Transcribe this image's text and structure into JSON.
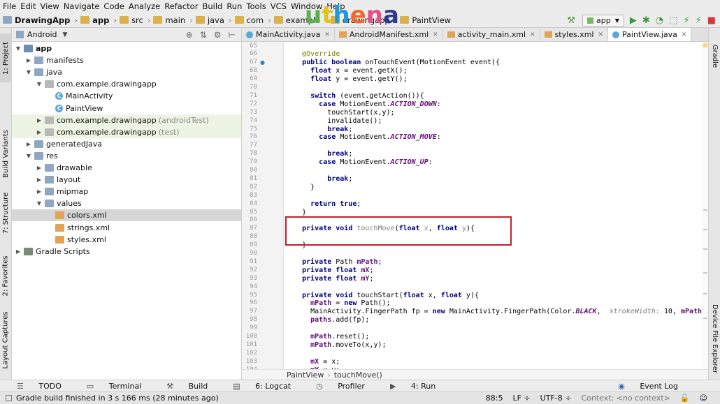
{
  "menu": [
    "File",
    "Edit",
    "View",
    "Navigate",
    "Code",
    "Analyze",
    "Refactor",
    "Build",
    "Run",
    "Tools",
    "VCS",
    "Window",
    "Help"
  ],
  "breadcrumbs": [
    {
      "label": "DrawingApp",
      "bold": true
    },
    {
      "label": "app",
      "bold": true
    },
    {
      "label": "src",
      "bold": false
    },
    {
      "label": "main",
      "bold": false
    },
    {
      "label": "java",
      "bold": false
    },
    {
      "label": "com",
      "bold": false
    },
    {
      "label": "example",
      "bold": false
    },
    {
      "label": "drawingapp",
      "bold": false
    },
    {
      "label": "PaintView",
      "bold": false
    }
  ],
  "watermark": "uthena",
  "watermark_colors": [
    "#5ab04a",
    "#e0c21d",
    "#1e9bd7",
    "#ec6a2c",
    "#e84e88",
    "#2c3a8c"
  ],
  "run_config": "app",
  "project_panel": {
    "view": "Android",
    "tree": [
      {
        "label": "app",
        "depth": 0,
        "open": true,
        "icon": "mod",
        "bold": true
      },
      {
        "label": "manifests",
        "depth": 1,
        "open": false,
        "icon": "folder"
      },
      {
        "label": "java",
        "depth": 1,
        "open": true,
        "icon": "folder"
      },
      {
        "label": "com.example.drawingapp",
        "depth": 2,
        "open": true,
        "icon": "pkg"
      },
      {
        "label": "MainActivity",
        "depth": 3,
        "icon": "java"
      },
      {
        "label": "PaintView",
        "depth": 3,
        "icon": "java"
      },
      {
        "label": "com.example.drawingapp",
        "suffix": "(androidTest)",
        "depth": 2,
        "open": false,
        "icon": "pkg",
        "green": true
      },
      {
        "label": "com.example.drawingapp",
        "suffix": "(test)",
        "depth": 2,
        "open": false,
        "icon": "pkg",
        "green": true
      },
      {
        "label": "generatedJava",
        "depth": 1,
        "open": false,
        "icon": "folder"
      },
      {
        "label": "res",
        "depth": 1,
        "open": true,
        "icon": "res"
      },
      {
        "label": "drawable",
        "depth": 2,
        "open": false,
        "icon": "folder"
      },
      {
        "label": "layout",
        "depth": 2,
        "open": false,
        "icon": "folder"
      },
      {
        "label": "mipmap",
        "depth": 2,
        "open": false,
        "icon": "folder"
      },
      {
        "label": "values",
        "depth": 2,
        "open": true,
        "icon": "folder"
      },
      {
        "label": "colors.xml",
        "depth": 3,
        "icon": "xml",
        "selected": true
      },
      {
        "label": "strings.xml",
        "depth": 3,
        "icon": "xml"
      },
      {
        "label": "styles.xml",
        "depth": 3,
        "icon": "xml"
      },
      {
        "label": "Gradle Scripts",
        "depth": 0,
        "open": false,
        "icon": "gradle"
      }
    ]
  },
  "left_tool_tabs": [
    "1: Project",
    "Build Variants",
    "7: Structure",
    "2: Favorites",
    "Layout Captures"
  ],
  "right_tool_tabs": [
    "Gradle",
    "Device File Explorer"
  ],
  "editor_tabs": [
    {
      "label": "MainActivity.java",
      "icon": "java"
    },
    {
      "label": "AndroidManifest.xml",
      "icon": "xml"
    },
    {
      "label": "activity_main.xml",
      "icon": "xml"
    },
    {
      "label": "styles.xml",
      "icon": "xml"
    },
    {
      "label": "PaintView.java",
      "icon": "java",
      "active": true
    }
  ],
  "code": [
    {
      "n": "65",
      "t": []
    },
    {
      "n": "66",
      "t": [
        {
          "s": "    @Override",
          "c": "ann"
        }
      ]
    },
    {
      "n": "67",
      "t": [
        {
          "s": "    ",
          "c": ""
        },
        {
          "s": "public boolean ",
          "c": "kw"
        },
        {
          "s": "onTouchEvent",
          "c": "mdecl"
        },
        {
          "s": "(MotionEvent event){",
          "c": ""
        }
      ]
    },
    {
      "n": "68",
      "t": [
        {
          "s": "      ",
          "c": ""
        },
        {
          "s": "float ",
          "c": "kw"
        },
        {
          "s": "x = event.getX();",
          "c": ""
        }
      ]
    },
    {
      "n": "69",
      "t": [
        {
          "s": "      ",
          "c": ""
        },
        {
          "s": "float ",
          "c": "kw"
        },
        {
          "s": "y = event.getY();",
          "c": ""
        }
      ]
    },
    {
      "n": "70",
      "t": []
    },
    {
      "n": "71",
      "t": [
        {
          "s": "      ",
          "c": ""
        },
        {
          "s": "switch ",
          "c": "kw"
        },
        {
          "s": "(event.getAction()){",
          "c": ""
        }
      ]
    },
    {
      "n": "72",
      "t": [
        {
          "s": "        ",
          "c": ""
        },
        {
          "s": "case ",
          "c": "kw"
        },
        {
          "s": "MotionEvent.",
          "c": ""
        },
        {
          "s": "ACTION_DOWN",
          "c": "const"
        },
        {
          "s": ":",
          "c": ""
        }
      ]
    },
    {
      "n": "73",
      "t": [
        {
          "s": "          touchStart(x,y);",
          "c": ""
        }
      ]
    },
    {
      "n": "74",
      "t": [
        {
          "s": "          invalidate();",
          "c": ""
        }
      ]
    },
    {
      "n": "75",
      "t": [
        {
          "s": "          ",
          "c": ""
        },
        {
          "s": "break",
          "c": "kw"
        },
        {
          "s": ";",
          "c": ""
        }
      ]
    },
    {
      "n": "76",
      "t": [
        {
          "s": "        ",
          "c": ""
        },
        {
          "s": "case ",
          "c": "kw"
        },
        {
          "s": "MotionEvent.",
          "c": ""
        },
        {
          "s": "ACTION_MOVE",
          "c": "const"
        },
        {
          "s": ":",
          "c": ""
        }
      ]
    },
    {
      "n": "77",
      "t": []
    },
    {
      "n": "78",
      "t": [
        {
          "s": "          ",
          "c": ""
        },
        {
          "s": "break",
          "c": "kw"
        },
        {
          "s": ";",
          "c": ""
        }
      ]
    },
    {
      "n": "79",
      "t": [
        {
          "s": "        ",
          "c": ""
        },
        {
          "s": "case ",
          "c": "kw"
        },
        {
          "s": "MotionEvent.",
          "c": ""
        },
        {
          "s": "ACTION_UP",
          "c": "const"
        },
        {
          "s": ":",
          "c": ""
        }
      ]
    },
    {
      "n": "80",
      "t": []
    },
    {
      "n": "81",
      "t": [
        {
          "s": "          ",
          "c": ""
        },
        {
          "s": "break",
          "c": "kw"
        },
        {
          "s": ";",
          "c": ""
        }
      ]
    },
    {
      "n": "82",
      "t": [
        {
          "s": "      }",
          "c": ""
        }
      ]
    },
    {
      "n": "83",
      "t": []
    },
    {
      "n": "84",
      "t": [
        {
          "s": "      ",
          "c": ""
        },
        {
          "s": "return true",
          "c": "kw"
        },
        {
          "s": ";",
          "c": ""
        }
      ]
    },
    {
      "n": "85",
      "t": [
        {
          "s": "    }",
          "c": ""
        }
      ]
    },
    {
      "n": "86",
      "t": []
    },
    {
      "n": "87",
      "t": [
        {
          "s": "    ",
          "c": ""
        },
        {
          "s": "private void ",
          "c": "kw"
        },
        {
          "s": "touchMove",
          "c": "unused"
        },
        {
          "s": "(",
          "c": ""
        },
        {
          "s": "float ",
          "c": "kw"
        },
        {
          "s": "x",
          "c": "unused"
        },
        {
          "s": ", ",
          "c": ""
        },
        {
          "s": "float ",
          "c": "kw"
        },
        {
          "s": "y",
          "c": "unused"
        },
        {
          "s": "){",
          "c": ""
        }
      ]
    },
    {
      "n": "88",
      "t": []
    },
    {
      "n": "89",
      "t": [
        {
          "s": "    }",
          "c": ""
        }
      ]
    },
    {
      "n": "90",
      "t": []
    },
    {
      "n": "91",
      "t": [
        {
          "s": "    ",
          "c": ""
        },
        {
          "s": "private ",
          "c": "kw"
        },
        {
          "s": "Path ",
          "c": ""
        },
        {
          "s": "mPath",
          "c": "field"
        },
        {
          "s": ";",
          "c": ""
        }
      ]
    },
    {
      "n": "92",
      "t": [
        {
          "s": "    ",
          "c": ""
        },
        {
          "s": "private float ",
          "c": "kw"
        },
        {
          "s": "mX",
          "c": "field"
        },
        {
          "s": ";",
          "c": ""
        }
      ]
    },
    {
      "n": "93",
      "t": [
        {
          "s": "    ",
          "c": ""
        },
        {
          "s": "private float ",
          "c": "kw"
        },
        {
          "s": "mY",
          "c": "field"
        },
        {
          "s": ";",
          "c": ""
        }
      ]
    },
    {
      "n": "94",
      "t": []
    },
    {
      "n": "95",
      "t": [
        {
          "s": "    ",
          "c": ""
        },
        {
          "s": "private void ",
          "c": "kw"
        },
        {
          "s": "touchStart(",
          "c": ""
        },
        {
          "s": "float ",
          "c": "kw"
        },
        {
          "s": "x, ",
          "c": ""
        },
        {
          "s": "float ",
          "c": "kw"
        },
        {
          "s": "y){",
          "c": ""
        }
      ]
    },
    {
      "n": "96",
      "t": [
        {
          "s": "      ",
          "c": ""
        },
        {
          "s": "mPath",
          "c": "field"
        },
        {
          "s": " = ",
          "c": ""
        },
        {
          "s": "new ",
          "c": "kw"
        },
        {
          "s": "Path();",
          "c": ""
        }
      ]
    },
    {
      "n": "97",
      "t": [
        {
          "s": "      MainActivity.FingerPath fp = ",
          "c": ""
        },
        {
          "s": "new ",
          "c": "kw"
        },
        {
          "s": "MainActivity.FingerPath(Color.",
          "c": ""
        },
        {
          "s": "BLACK",
          "c": "constb"
        },
        {
          "s": ",  ",
          "c": ""
        },
        {
          "s": "strokeWidth:",
          "c": "hint"
        },
        {
          "s": " 10, ",
          "c": ""
        },
        {
          "s": "mPath",
          "c": "field"
        },
        {
          "s": ");",
          "c": ""
        }
      ]
    },
    {
      "n": "98",
      "t": [
        {
          "s": "      ",
          "c": ""
        },
        {
          "s": "paths",
          "c": "field"
        },
        {
          "s": ".add(fp);",
          "c": ""
        }
      ]
    },
    {
      "n": "99",
      "t": []
    },
    {
      "n": "100",
      "t": [
        {
          "s": "      ",
          "c": ""
        },
        {
          "s": "mPath",
          "c": "field"
        },
        {
          "s": ".reset();",
          "c": ""
        }
      ]
    },
    {
      "n": "101",
      "t": [
        {
          "s": "      ",
          "c": ""
        },
        {
          "s": "mPath",
          "c": "field"
        },
        {
          "s": ".moveTo(x,y);",
          "c": ""
        }
      ]
    },
    {
      "n": "102",
      "t": []
    },
    {
      "n": "103",
      "t": [
        {
          "s": "      ",
          "c": ""
        },
        {
          "s": "mX",
          "c": "field"
        },
        {
          "s": " = x;",
          "c": ""
        }
      ]
    },
    {
      "n": "104",
      "t": [
        {
          "s": "      ",
          "c": ""
        },
        {
          "s": "mY",
          "c": "field"
        },
        {
          "s": " = y;",
          "c": ""
        }
      ]
    }
  ],
  "syntax_colors": {
    "kw": "#000080",
    "ann": "#808000",
    "mdecl": "#000000",
    "const": "#660e7a",
    "constb": "#660e7a",
    "unused": "#808080",
    "field": "#660e7a",
    "hint": "#787878"
  },
  "editor_breadcrumb": [
    "PaintView",
    "touchMove()"
  ],
  "bottom_tabs": [
    "TODO",
    "Terminal",
    "Build",
    "6: Logcat",
    "Profiler",
    "4: Run"
  ],
  "event_log": "Event Log",
  "status": {
    "message": "Gradle build finished in 3 s 166 ms (28 minutes ago)",
    "position": "88:5",
    "line_sep": "LF ÷",
    "encoding": "UTF-8 ÷",
    "context": "Context: <no context>"
  }
}
